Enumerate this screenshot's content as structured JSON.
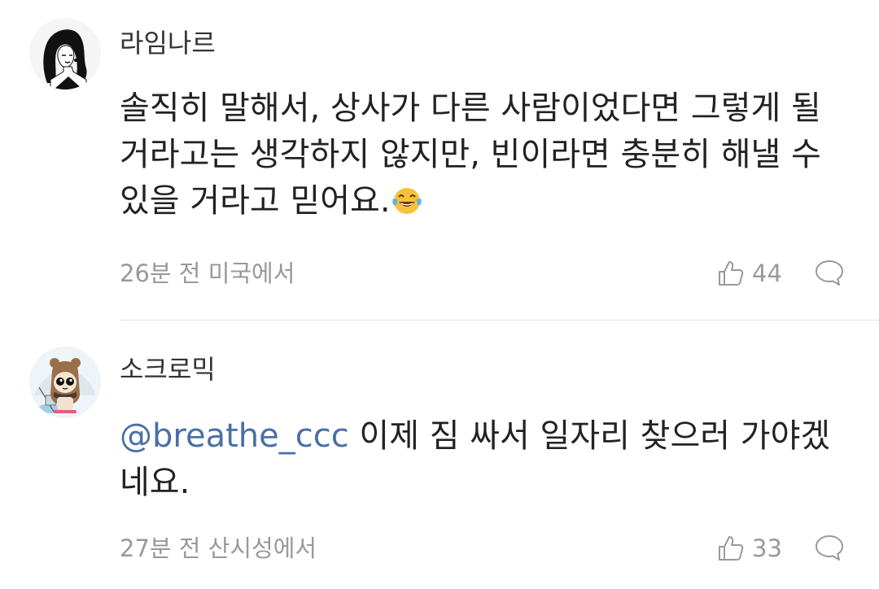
{
  "comments": [
    {
      "username": "라임나르",
      "text_before_emoji": "솔직히 말해서, 상사가 다른 사람이었다면 그렇게 될 거라고는 생각하지 않지만, 빈이라면 충분히 해낼 수 있을 거라고 믿어요.",
      "emoji": "face-with-tears-of-joy",
      "meta": "26분 전 미국에서",
      "likes": "44"
    },
    {
      "username": "소크로믹",
      "mention": "@breathe_ccc",
      "text": " 이제 짐 싸서 일자리 찾으러 가야겠네요.",
      "meta": "27분 전 산시성에서",
      "likes": "33"
    }
  ],
  "colors": {
    "mention": "#4a6fa5",
    "meta": "#999999",
    "text": "#222222",
    "divider": "#e5e5e5"
  },
  "icons": {
    "like": "thumbs-up-icon",
    "reply": "speech-bubble-icon"
  }
}
